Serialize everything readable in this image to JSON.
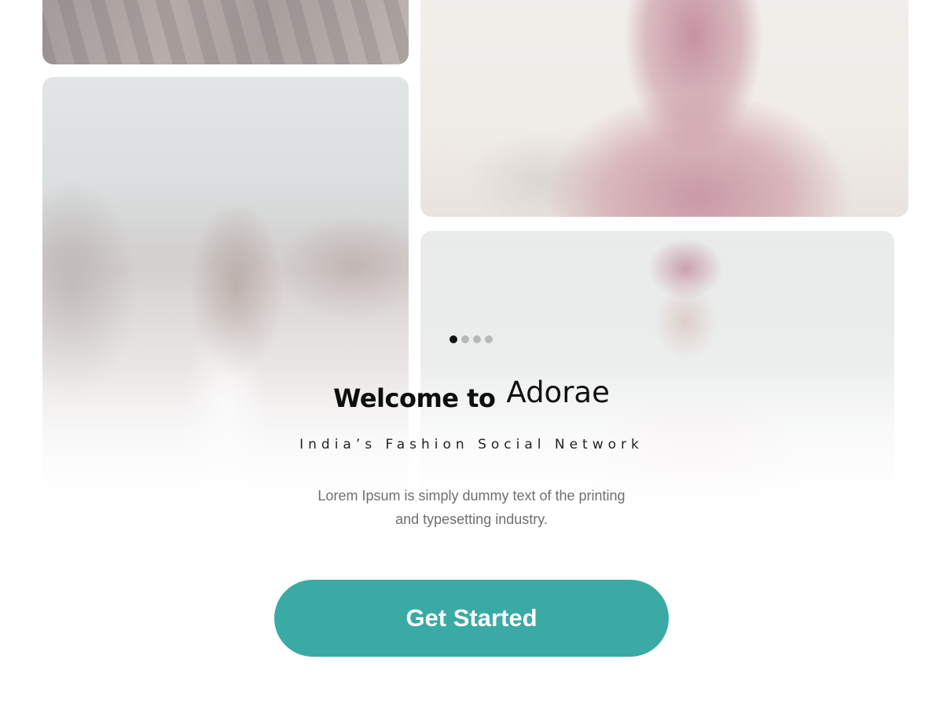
{
  "gallery": {
    "photos": [
      {
        "label": "photo-fabric"
      },
      {
        "label": "photo-pink-dress"
      },
      {
        "label": "photo-beach-woman"
      },
      {
        "label": "photo-man-turban"
      }
    ]
  },
  "carousel": {
    "page_count": 4,
    "active_index": 0
  },
  "welcome": {
    "prefix": "Welcome to",
    "brand": "Adorae"
  },
  "tagline": "India’s Fashion Social Network",
  "description": "Lorem Ipsum is simply dummy text of the printing and typesetting industry.",
  "cta": {
    "label": "Get Started",
    "color": "#3aaaa4"
  },
  "colors": {
    "dot_active": "#111111",
    "dot_inactive": "#b8b8b8"
  }
}
